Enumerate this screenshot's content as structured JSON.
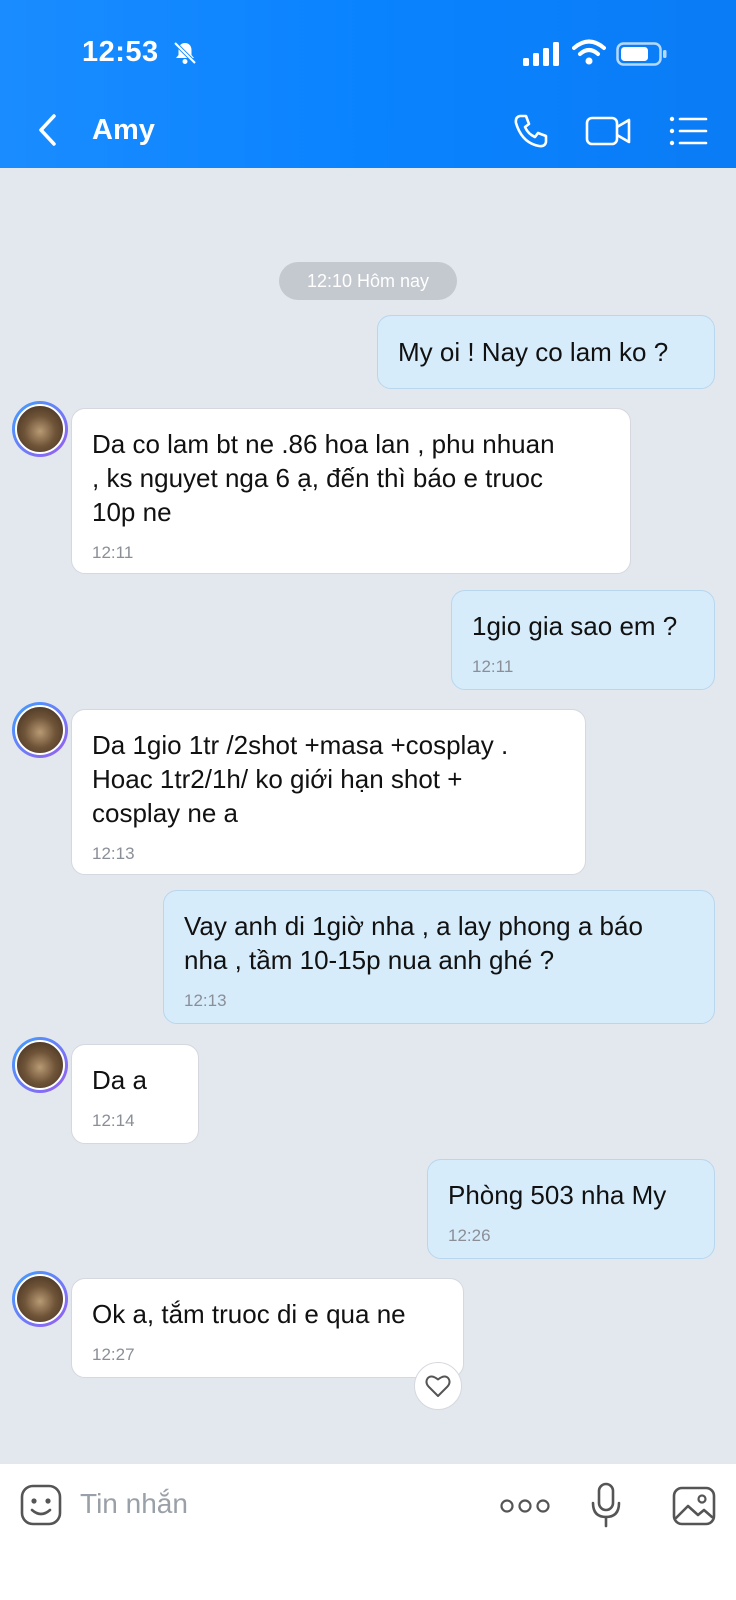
{
  "status_bar": {
    "time": "12:53"
  },
  "header": {
    "contact_name": "Amy"
  },
  "chat": {
    "date_separator": "12:10 Hôm nay",
    "messages": [
      {
        "direction": "out",
        "text": "My oi ! Nay co lam ko ?",
        "time": ""
      },
      {
        "direction": "in",
        "text": "Da co lam bt ne .86 hoa lan , phu nhuan\n, ks nguyet nga 6 ạ, đến thì báo e truoc\n10p  ne",
        "time": "12:11"
      },
      {
        "direction": "out",
        "text": "1gio gia sao em ?",
        "time": "12:11"
      },
      {
        "direction": "in",
        "text": "Da 1gio 1tr /2shot +masa +cosplay .\nHoac 1tr2/1h/ ko giới hạn shot +\ncosplay ne a",
        "time": "12:13"
      },
      {
        "direction": "out",
        "text": "Vay anh di 1giờ nha , a lay phong a báo\nnha , tầm 10-15p nua anh ghé ?",
        "time": "12:13"
      },
      {
        "direction": "in",
        "text": "Da a",
        "time": "12:14"
      },
      {
        "direction": "out",
        "text": "Phòng 503 nha My",
        "time": "12:26"
      },
      {
        "direction": "in",
        "text": "Ok a, tắm truoc di e qua ne",
        "time": "12:27"
      }
    ]
  },
  "composer": {
    "placeholder": "Tin nhắn"
  },
  "icons": {
    "back": "chevron-left-icon",
    "phone": "phone-icon",
    "video": "video-camera-icon",
    "menu": "list-menu-icon",
    "sticker": "sticker-icon",
    "more": "more-dots-icon",
    "mic": "microphone-icon",
    "image": "image-icon",
    "heart": "heart-icon"
  },
  "colors": {
    "header": "#0a83ff",
    "background": "#e3e7ee",
    "outgoing_bubble": "#d7ecfb",
    "incoming_bubble": "#ffffff"
  }
}
